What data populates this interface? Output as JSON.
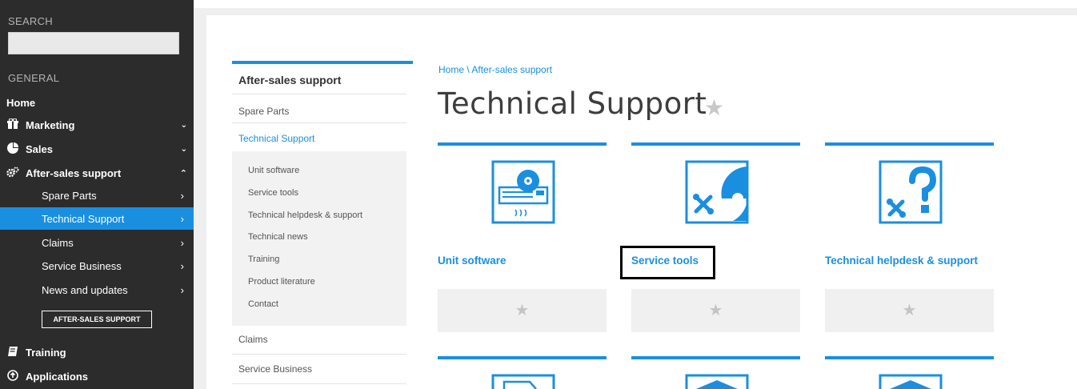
{
  "sidebar": {
    "search_label": "SEARCH",
    "general_label": "GENERAL",
    "home": "Home",
    "items": [
      {
        "label": "Marketing",
        "icon": "gift-icon"
      },
      {
        "label": "Sales",
        "icon": "pie-chart-icon"
      },
      {
        "label": "After-sales support",
        "icon": "gears-icon"
      }
    ],
    "sub_items": [
      {
        "label": "Spare Parts"
      },
      {
        "label": "Technical Support"
      },
      {
        "label": "Claims"
      },
      {
        "label": "Service Business"
      },
      {
        "label": "News and updates"
      }
    ],
    "cta": "AFTER-SALES SUPPORT",
    "training": "Training",
    "applications": "Applications"
  },
  "subnav": {
    "title": "After-sales support",
    "items": {
      "spare_parts": "Spare Parts",
      "technical_support": "Technical Support",
      "claims": "Claims",
      "service_business": "Service Business"
    },
    "children": [
      "Unit software",
      "Service tools",
      "Technical helpdesk & support",
      "Technical news",
      "Training",
      "Product literature",
      "Contact"
    ]
  },
  "main": {
    "breadcrumb": "Home \\ After-sales support",
    "title": "Technical Support",
    "cards": [
      {
        "label": "Unit software",
        "icon": "unit-software-icon"
      },
      {
        "label": "Service tools",
        "icon": "service-tools-icon"
      },
      {
        "label": "Technical helpdesk & support",
        "icon": "helpdesk-icon"
      }
    ]
  },
  "colors": {
    "accent": "#1a8fe0",
    "sidebar_bg": "#2c2c2c",
    "title": "#3d3d3d"
  }
}
